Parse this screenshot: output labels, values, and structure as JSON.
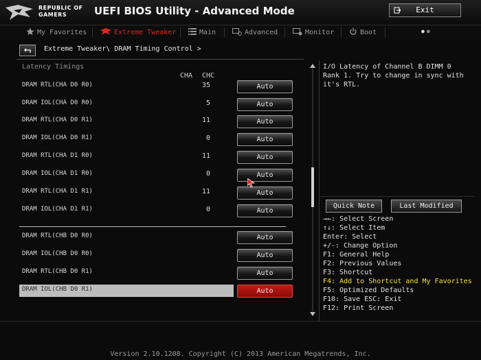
{
  "header": {
    "brand_line1": "REPUBLIC OF",
    "brand_line2": "GAMERS",
    "title": "UEFI BIOS Utility - Advanced Mode",
    "exit_label": "Exit"
  },
  "tabs": [
    {
      "label": "My Favorites",
      "icon": "star-icon"
    },
    {
      "label": "Extreme Tweaker",
      "icon": "rog-eye-icon",
      "active": true
    },
    {
      "label": "Main",
      "icon": "list-icon"
    },
    {
      "label": "Advanced",
      "icon": "advanced-icon"
    },
    {
      "label": "Monitor",
      "icon": "monitor-gear-icon"
    },
    {
      "label": "Boot",
      "icon": "power-icon"
    }
  ],
  "breadcrumb": "Extreme Tweaker\\ DRAM Timing Control >",
  "section_label": "Latency Timings",
  "columns": {
    "cha": "CHA",
    "chc": "CHC"
  },
  "rows": [
    {
      "label": "DRAM RTL(CHA D0 R0)",
      "value": "35",
      "option": "Auto"
    },
    {
      "label": "DRAM IOL(CHA D0 R0)",
      "value": "5",
      "option": "Auto"
    },
    {
      "label": "DRAM RTL(CHA D0 R1)",
      "value": "11",
      "option": "Auto"
    },
    {
      "label": "DRAM IOL(CHA D0 R1)",
      "value": "0",
      "option": "Auto"
    },
    {
      "label": "DRAM RTL(CHA D1 R0)",
      "value": "11",
      "option": "Auto"
    },
    {
      "label": "DRAM IOL(CHA D1 R0)",
      "value": "0",
      "option": "Auto"
    },
    {
      "label": "DRAM RTL(CHA D1 R1)",
      "value": "11",
      "option": "Auto"
    },
    {
      "label": "DRAM IOL(CHA D1 R1)",
      "value": "0",
      "option": "Auto"
    },
    {
      "label": "DRAM RTL(CHB D0 R0)",
      "value": "",
      "option": "Auto"
    },
    {
      "label": "DRAM IOL(CHB D0 R0)",
      "value": "",
      "option": "Auto"
    },
    {
      "label": "DRAM RTL(CHB D0 R1)",
      "value": "",
      "option": "Auto"
    },
    {
      "label": "DRAM IOL(CHB D0 R1)",
      "value": "",
      "option": "Auto",
      "selected": true
    }
  ],
  "help_text": "I/O Latency of Channel B DIMM 0 Rank 1. Try to change in sync with it's RTL.",
  "quick_note_label": "Quick Note",
  "last_modified_label": "Last Modified",
  "keys": [
    {
      "text": "→←: Select Screen"
    },
    {
      "text": "↑↓: Select Item"
    },
    {
      "text": "Enter: Select"
    },
    {
      "text": "+/-: Change Option"
    },
    {
      "text": "F1: General Help"
    },
    {
      "text": "F2: Previous Values"
    },
    {
      "text": "F3: Shortcut"
    },
    {
      "text": "F4: Add to Shortcut and My Favorites",
      "highlight": true
    },
    {
      "text": "F5: Optimized Defaults"
    },
    {
      "text": "F10: Save  ESC: Exit"
    },
    {
      "text": "F12: Print Screen"
    }
  ],
  "footer": "Version 2.10.1208. Copyright (C) 2013 American Megatrends, Inc.",
  "colors": {
    "accent": "#d9281f",
    "highlight": "#f0e23a",
    "background": "#0b0b0b"
  }
}
